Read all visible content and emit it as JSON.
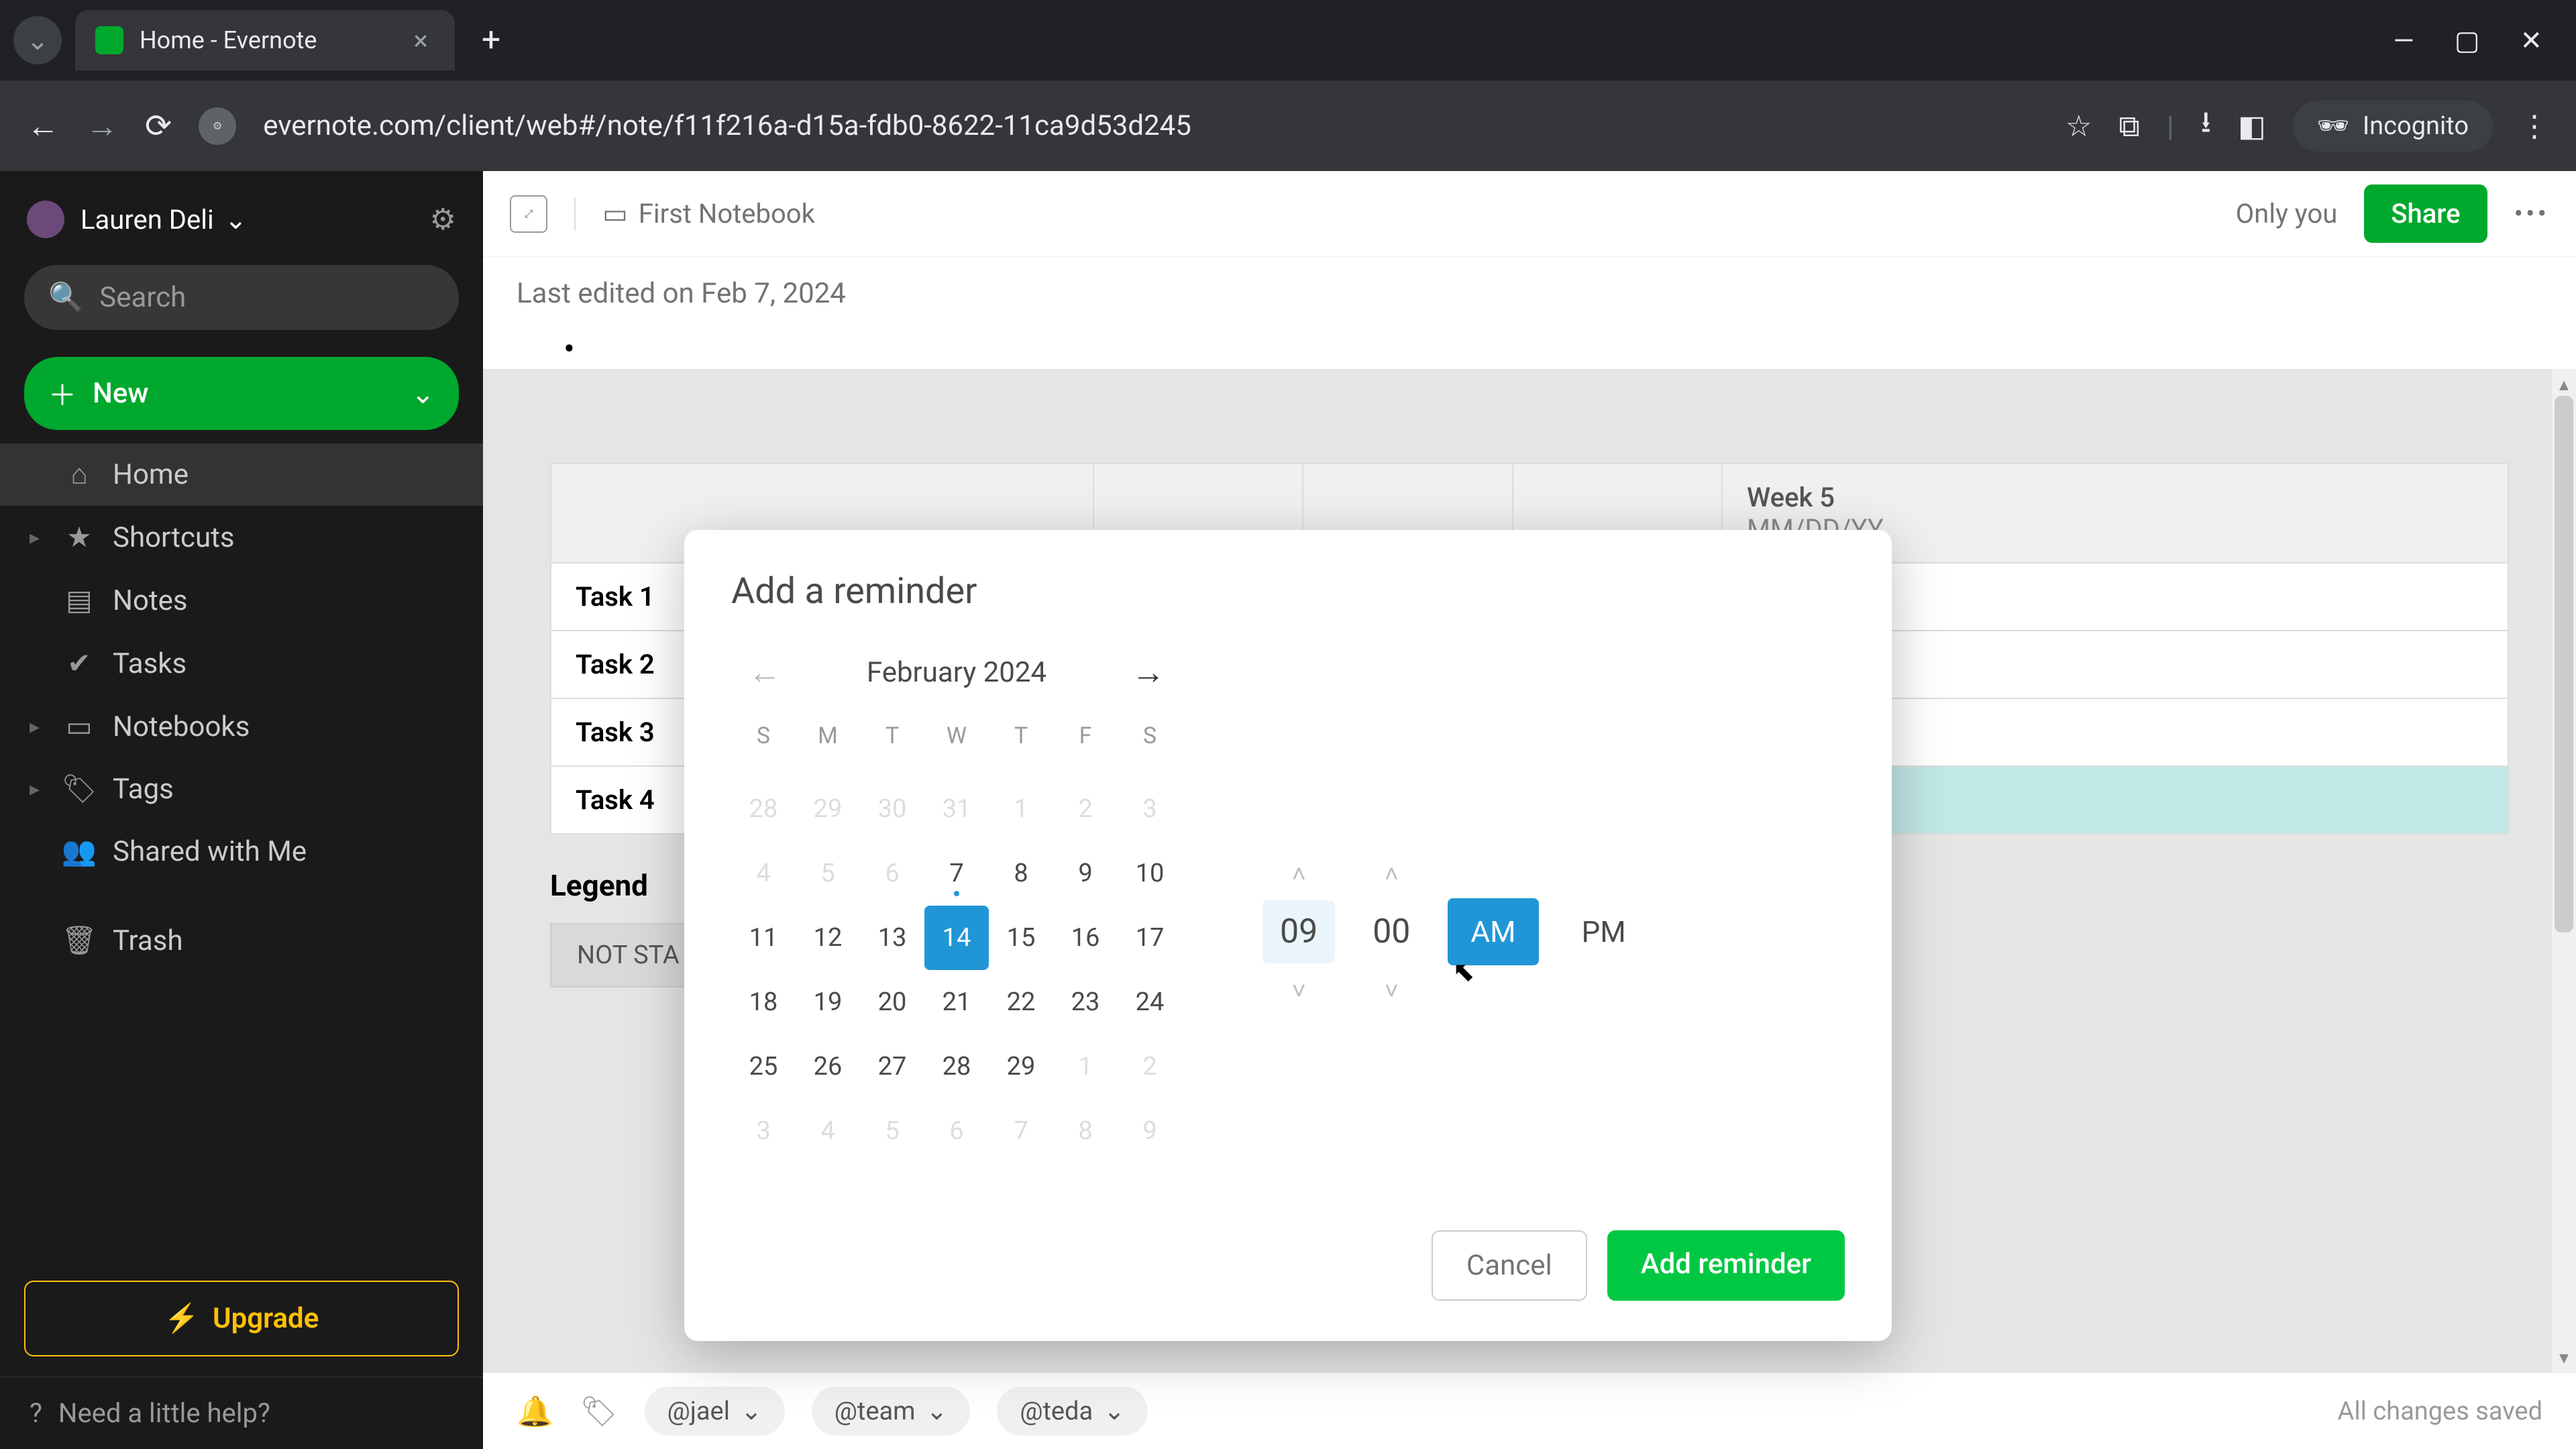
{
  "browser": {
    "tab_title": "Home - Evernote",
    "url": "evernote.com/client/web#/note/f11f216a-d15a-fdb0-8622-11ca9d53d245",
    "incognito_label": "Incognito"
  },
  "sidebar": {
    "user_name": "Lauren Deli",
    "search_placeholder": "Search",
    "new_label": "New",
    "items": [
      {
        "icon": "home-icon",
        "label": "Home",
        "active": true
      },
      {
        "icon": "star-icon",
        "label": "Shortcuts",
        "expandable": true
      },
      {
        "icon": "note-icon",
        "label": "Notes"
      },
      {
        "icon": "check-icon",
        "label": "Tasks"
      },
      {
        "icon": "notebook-icon",
        "label": "Notebooks",
        "expandable": true
      },
      {
        "icon": "tag-icon",
        "label": "Tags",
        "expandable": true
      },
      {
        "icon": "people-icon",
        "label": "Shared with Me"
      },
      {
        "icon": "trash-icon",
        "label": "Trash"
      }
    ],
    "upgrade_label": "Upgrade",
    "help_label": "Need a little help?"
  },
  "note_header": {
    "notebook_name": "First Notebook",
    "only_you": "Only you",
    "share_label": "Share"
  },
  "note": {
    "last_edited": "Last edited on Feb 7, 2024",
    "table": {
      "headers": [
        "",
        "",
        "",
        "",
        "Week 5"
      ],
      "date_placeholder": "MM/DD/YY",
      "rows": [
        "Task 1",
        "Task 2",
        "Task 3",
        "Task 4"
      ]
    },
    "legend_title": "Legend",
    "legend_chip": "NOT STA"
  },
  "footer": {
    "mentions": [
      "@jael",
      "@team",
      "@teda"
    ],
    "save_status": "All changes saved"
  },
  "modal": {
    "title": "Add a reminder",
    "month_label": "February 2024",
    "dow": [
      "S",
      "M",
      "T",
      "W",
      "T",
      "F",
      "S"
    ],
    "weeks": [
      [
        {
          "d": "28",
          "o": true
        },
        {
          "d": "29",
          "o": true
        },
        {
          "d": "30",
          "o": true
        },
        {
          "d": "31",
          "o": true
        },
        {
          "d": "1",
          "o": true
        },
        {
          "d": "2",
          "o": true
        },
        {
          "d": "3",
          "o": true
        }
      ],
      [
        {
          "d": "4",
          "o": true
        },
        {
          "d": "5",
          "o": true
        },
        {
          "d": "6",
          "o": true
        },
        {
          "d": "7",
          "today": true
        },
        {
          "d": "8"
        },
        {
          "d": "9"
        },
        {
          "d": "10"
        }
      ],
      [
        {
          "d": "11"
        },
        {
          "d": "12"
        },
        {
          "d": "13"
        },
        {
          "d": "14",
          "sel": true
        },
        {
          "d": "15"
        },
        {
          "d": "16"
        },
        {
          "d": "17"
        }
      ],
      [
        {
          "d": "18"
        },
        {
          "d": "19"
        },
        {
          "d": "20"
        },
        {
          "d": "21"
        },
        {
          "d": "22"
        },
        {
          "d": "23"
        },
        {
          "d": "24"
        }
      ],
      [
        {
          "d": "25"
        },
        {
          "d": "26"
        },
        {
          "d": "27"
        },
        {
          "d": "28"
        },
        {
          "d": "29"
        },
        {
          "d": "1",
          "o": true
        },
        {
          "d": "2",
          "o": true
        }
      ],
      [
        {
          "d": "3",
          "o": true
        },
        {
          "d": "4",
          "o": true
        },
        {
          "d": "5",
          "o": true
        },
        {
          "d": "6",
          "o": true
        },
        {
          "d": "7",
          "o": true
        },
        {
          "d": "8",
          "o": true
        },
        {
          "d": "9",
          "o": true
        }
      ]
    ],
    "hour": "09",
    "minute": "00",
    "am": "AM",
    "pm": "PM",
    "cancel_label": "Cancel",
    "submit_label": "Add reminder"
  }
}
